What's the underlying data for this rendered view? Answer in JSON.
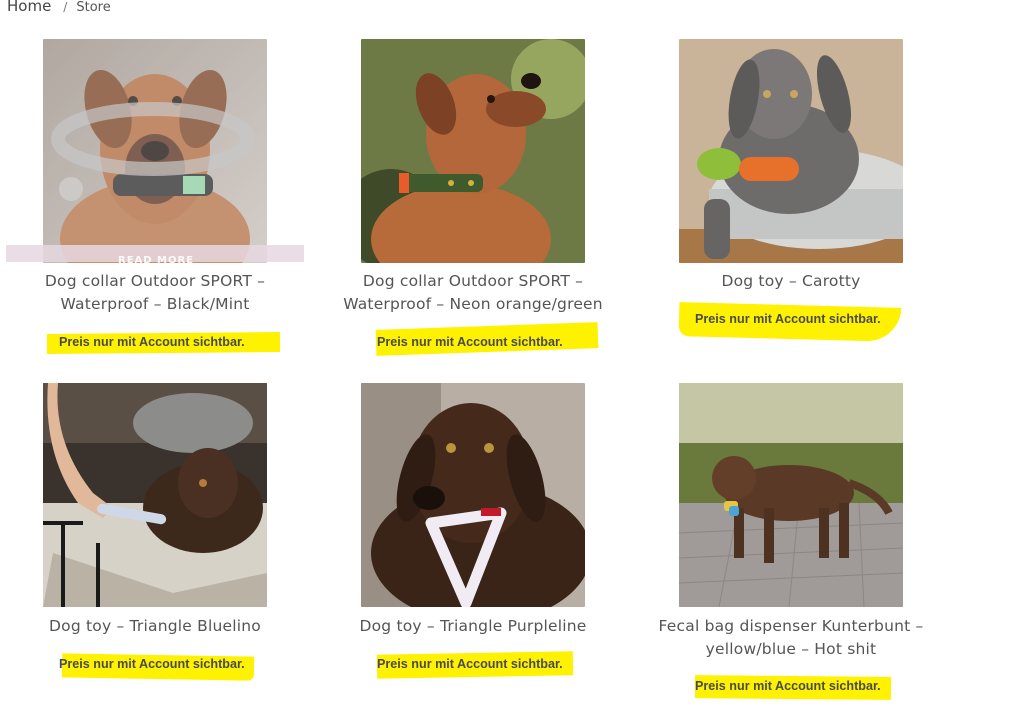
{
  "breadcrumb": {
    "home": "Home",
    "separator": "/",
    "current": "Store"
  },
  "overlay": {
    "read_more": "READ MORE"
  },
  "products": [
    {
      "title_line1": "Dog collar Outdoor SPORT –",
      "title_line2": "Waterproof – Black/Mint",
      "price_note": "Preis nur mit Account sichtbar.",
      "image": "rhodesian-ridgeback-black-collar"
    },
    {
      "title_line1": "Dog collar Outdoor SPORT –",
      "title_line2": "Waterproof – Neon orange/green",
      "price_note": "Preis nur mit Account sichtbar.",
      "image": "rhodesian-ridgeback-green-collar"
    },
    {
      "title_line1": "Dog toy – Carotty",
      "title_line2": "",
      "price_note": "Preis nur mit Account sichtbar.",
      "image": "weimaraner-puppy-carrot-toy"
    },
    {
      "title_line1": "Dog toy – Triangle Bluelino",
      "title_line2": "",
      "price_note": "Preis nur mit Account sichtbar.",
      "image": "labrador-triangle-blue"
    },
    {
      "title_line1": "Dog toy – Triangle Purpleline",
      "title_line2": "",
      "price_note": "Preis nur mit Account sichtbar.",
      "image": "labrador-triangle-purple"
    },
    {
      "title_line1": "Fecal bag dispenser Kunterbunt –",
      "title_line2": "yellow/blue – Hot shit",
      "price_note": "Preis nur mit Account sichtbar.",
      "image": "labrador-puppy-bag-dispenser"
    }
  ],
  "colors": {
    "highlight": "#fff200",
    "text": "#555555"
  }
}
